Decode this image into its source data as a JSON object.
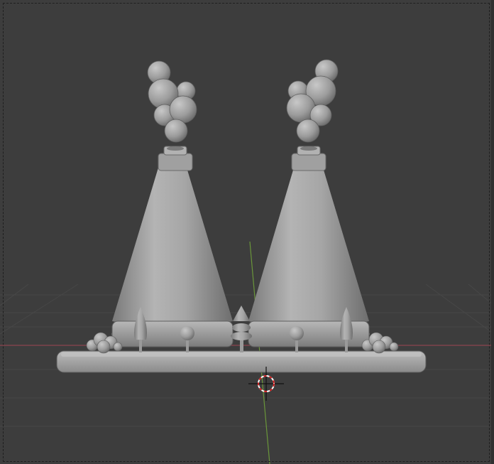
{
  "viewport": {
    "mode": "solid",
    "background_color": "#3d3d3d",
    "grid_color": "#454545",
    "x_axis_color": "#9a4a55",
    "y_axis_color": "#6f9a3c",
    "mesh_color": "#a8a8a8"
  },
  "scene": {
    "objects": [
      "power-plant-base",
      "cooling-tower-left",
      "cooling-tower-right",
      "smoke-left",
      "smoke-right",
      "trees",
      "bushes"
    ],
    "cursor": "3d-cursor-icon"
  }
}
